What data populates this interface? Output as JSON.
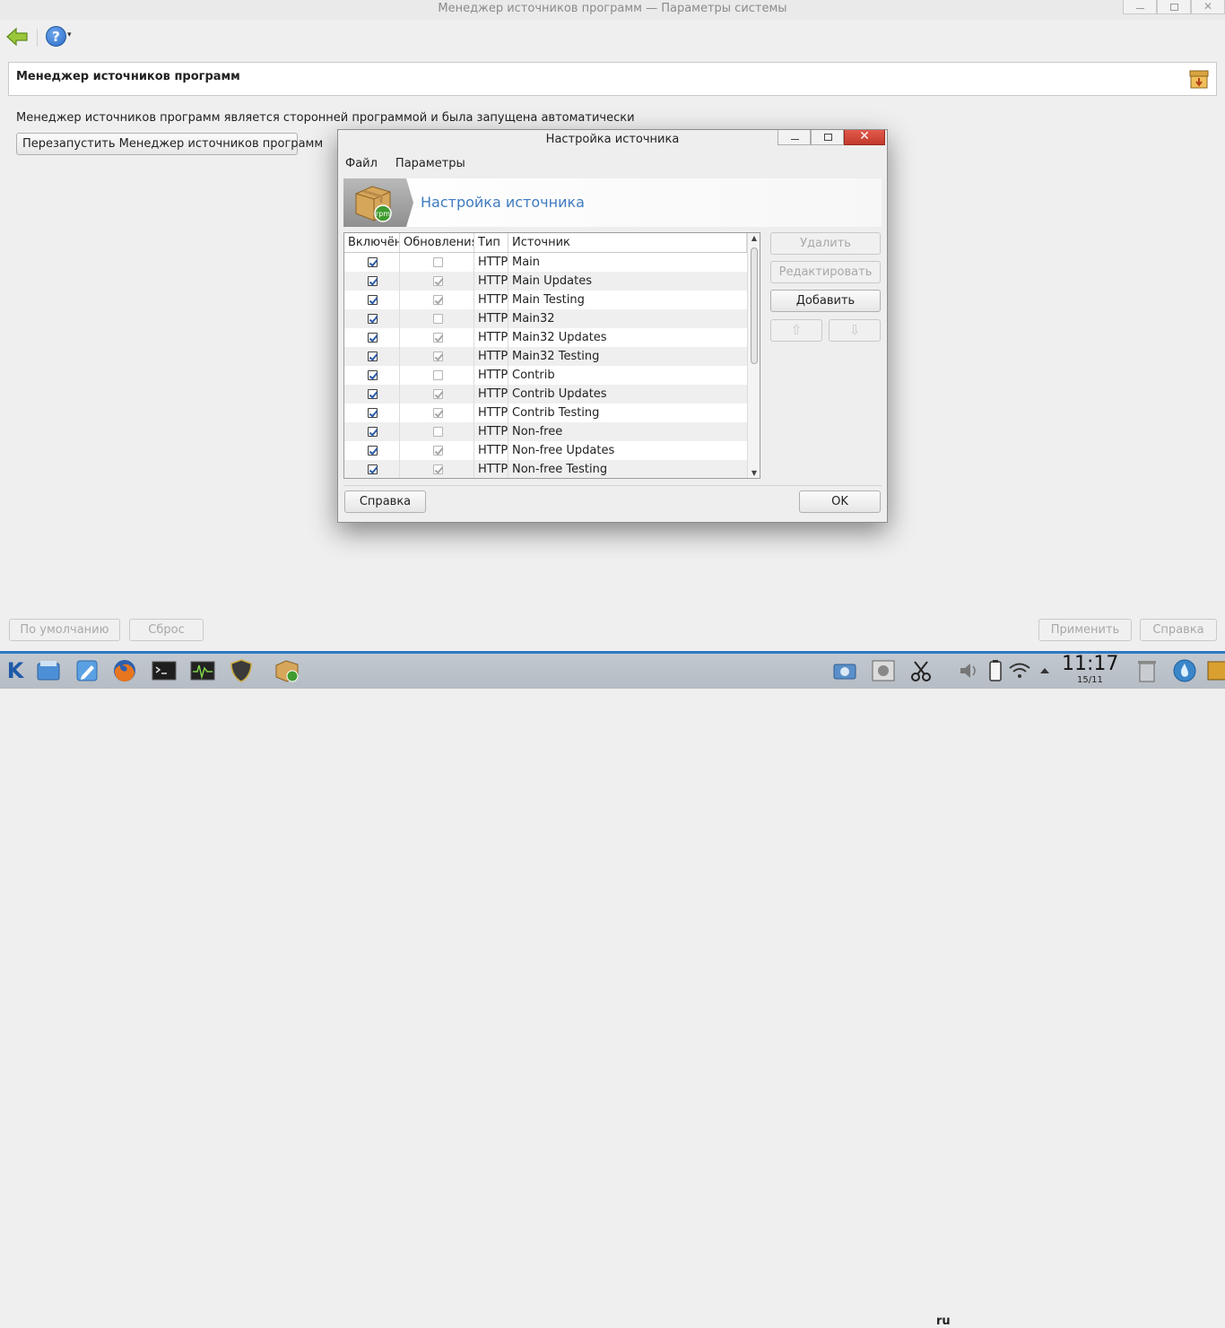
{
  "window": {
    "title": "Менеджер источников программ — Параметры системы",
    "close_glyph": "✕"
  },
  "toolbar": {
    "help_glyph": "?",
    "help_dropdown_glyph": "▾"
  },
  "header": {
    "title": "Менеджер источников программ"
  },
  "main": {
    "info_text": "Менеджер источников программ является сторонней программой и была запущена автоматически",
    "restart_label": "Перезапустить Менеджер источников программ"
  },
  "bottom": {
    "defaults_label": "По умолчанию",
    "reset_label": "Сброс",
    "apply_label": "Применить",
    "help_label": "Справка"
  },
  "dialog": {
    "title": "Настройка источника",
    "close_glyph": "✕",
    "menu": [
      "Файл",
      "Параметры"
    ],
    "banner_title": "Настройка источника",
    "columns": [
      "Включён",
      "Обновления",
      "Тип",
      "Источник"
    ],
    "rows": [
      {
        "enabled": true,
        "updates": false,
        "type": "HTTP",
        "source": "Main"
      },
      {
        "enabled": true,
        "updates": true,
        "type": "HTTP",
        "source": "Main Updates"
      },
      {
        "enabled": true,
        "updates": true,
        "type": "HTTP",
        "source": "Main Testing"
      },
      {
        "enabled": true,
        "updates": false,
        "type": "HTTP",
        "source": "Main32"
      },
      {
        "enabled": true,
        "updates": true,
        "type": "HTTP",
        "source": "Main32 Updates"
      },
      {
        "enabled": true,
        "updates": true,
        "type": "HTTP",
        "source": "Main32 Testing"
      },
      {
        "enabled": true,
        "updates": false,
        "type": "HTTP",
        "source": "Contrib"
      },
      {
        "enabled": true,
        "updates": true,
        "type": "HTTP",
        "source": "Contrib Updates"
      },
      {
        "enabled": true,
        "updates": true,
        "type": "HTTP",
        "source": "Contrib Testing"
      },
      {
        "enabled": true,
        "updates": false,
        "type": "HTTP",
        "source": "Non-free"
      },
      {
        "enabled": true,
        "updates": true,
        "type": "HTTP",
        "source": "Non-free Updates"
      },
      {
        "enabled": true,
        "updates": true,
        "type": "HTTP",
        "source": "Non-free Testing"
      }
    ],
    "buttons": {
      "delete": "Удалить",
      "edit": "Редактировать",
      "add": "Добавить",
      "up_glyph": "⇧",
      "down_glyph": "⇩",
      "help": "Справка",
      "ok": "OK"
    },
    "scroll_up_glyph": "▲",
    "scroll_down_glyph": "▼"
  },
  "taskbar": {
    "kmenu_glyph": "K",
    "keyboard_layout": "ru",
    "clock": "11:17",
    "date": "15/11",
    "apps": [
      "file-manager-icon",
      "text-editor-icon",
      "firefox-icon",
      "terminal-icon",
      "system-monitor-icon",
      "security-shield-icon",
      "package-manager-icon"
    ]
  },
  "colors": {
    "taskbar_accent": "#2f78c4",
    "banner_title": "#3f7bc0",
    "close_button": "#c9453a"
  }
}
